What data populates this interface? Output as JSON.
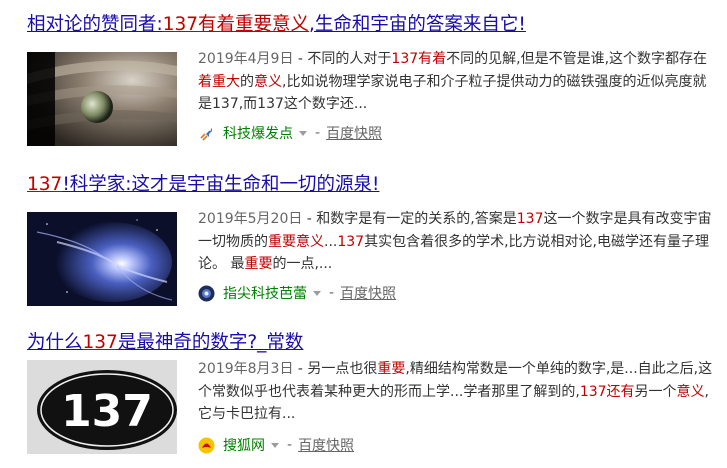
{
  "results": [
    {
      "title": [
        {
          "text": "相对论的赞同者:",
          "hl": false
        },
        {
          "text": "137有着重要意义",
          "hl": true
        },
        {
          "text": ",生命和宇宙的答案来自它!",
          "hl": false
        }
      ],
      "date": "2019年4月9日",
      "snippet": [
        {
          "text": " - 不同的人对于",
          "hl": false
        },
        {
          "text": "137有着",
          "hl": true
        },
        {
          "text": "不同的见解,但是不管是谁,这个数字都存在",
          "hl": false
        },
        {
          "text": "着重大",
          "hl": true
        },
        {
          "text": "的",
          "hl": false
        },
        {
          "text": "意义",
          "hl": true
        },
        {
          "text": ",比如说物理学家说电子和介子粒子提供动力的磁铁强度的近似亮度就是137,而137这个数字还...",
          "hl": false
        }
      ],
      "source": "科技爆发点",
      "separator": "-",
      "cache_label": "百度快照",
      "icon": "rocket-icon",
      "thumb": "planet-image"
    },
    {
      "title": [
        {
          "text": "137",
          "hl": true
        },
        {
          "text": "!科学家:这才是宇宙生命和一切的源泉!",
          "hl": false
        }
      ],
      "date": "2019年5月20日",
      "snippet": [
        {
          "text": " - 和数字是有一定的关系的,答案是",
          "hl": false
        },
        {
          "text": "137",
          "hl": true
        },
        {
          "text": "这一个数字是具有改变宇宙一切物质的",
          "hl": false
        },
        {
          "text": "重要意义",
          "hl": true
        },
        {
          "text": "...",
          "hl": false
        },
        {
          "text": "137",
          "hl": true
        },
        {
          "text": "其实包含着很多的学术,比方说相对论,电磁学还有量子理论。 最",
          "hl": false
        },
        {
          "text": "重要",
          "hl": true
        },
        {
          "text": "的一点,...",
          "hl": false
        }
      ],
      "source": "指尖科技芭蕾",
      "separator": "-",
      "cache_label": "百度快照",
      "icon": "globe-icon",
      "thumb": "galaxy-image"
    },
    {
      "title": [
        {
          "text": "为什么",
          "hl": false
        },
        {
          "text": "137",
          "hl": true
        },
        {
          "text": "是最神奇的数字?_常数",
          "hl": false
        }
      ],
      "date": "2019年8月3日",
      "snippet": [
        {
          "text": " - 另一点也很",
          "hl": false
        },
        {
          "text": "重要",
          "hl": true
        },
        {
          "text": ",精细结构常数是一个单纯的数字,是...自此之后,这个常数似乎也代表着某种更大的形而上学...学者那里了解到的,",
          "hl": false
        },
        {
          "text": "137还有",
          "hl": true
        },
        {
          "text": "另一个",
          "hl": false
        },
        {
          "text": "意义",
          "hl": true
        },
        {
          "text": ",它与卡巴拉有...",
          "hl": false
        }
      ],
      "source": "搜狐网",
      "separator": "-",
      "cache_label": "百度快照",
      "icon": "sohu-fox-icon",
      "thumb": "number-137-image",
      "thumb_text": "137"
    }
  ],
  "colors": {
    "link": "#1a0dab",
    "highlight": "#c00000",
    "source": "#008000",
    "text": "#333333",
    "meta": "#666666"
  }
}
